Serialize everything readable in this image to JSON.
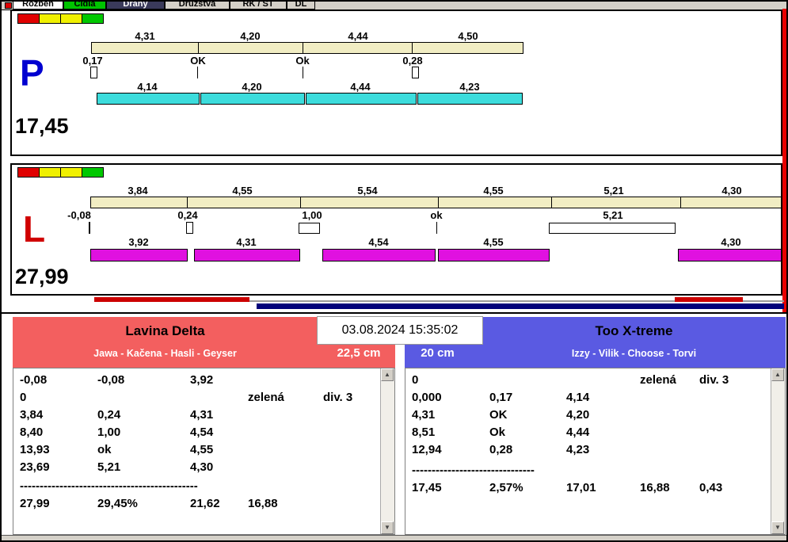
{
  "tabs": {
    "items": [
      "Rozbeh",
      "Čidla",
      "Dráhy",
      "Družstva",
      "RK / ST",
      "DL"
    ]
  },
  "lane_p": {
    "letter": "P",
    "total": "17,45",
    "splits": [
      "4,31",
      "4,20",
      "4,44",
      "4,50"
    ],
    "marks": [
      "0,17",
      "OK",
      "Ok",
      "0,28"
    ],
    "dogs": [
      "4,14",
      "4,20",
      "4,44",
      "4,23"
    ]
  },
  "lane_l": {
    "letter": "L",
    "total": "27,99",
    "splits": [
      "3,84",
      "4,55",
      "5,54",
      "4,55",
      "5,21",
      "4,30"
    ],
    "marks": [
      "-0,08",
      "0,24",
      "1,00",
      "ok",
      "5,21"
    ],
    "dogs": [
      "3,92",
      "4,31",
      "4,54",
      "4,55",
      "4,30"
    ]
  },
  "scoreboard": {
    "timestamp": "03.08.2024 15:35:02",
    "left": {
      "team": "Lavina Delta",
      "dogs": "Jawa - Kačena - Hasli - Geyser",
      "height": "22,5 cm",
      "rows": [
        [
          "-0,08",
          "-0,08",
          "3,92",
          "",
          ""
        ],
        [
          "0",
          "",
          "",
          "zelená",
          "div. 3"
        ],
        [
          "3,84",
          "0,24",
          "4,31",
          "",
          ""
        ],
        [
          "8,40",
          "1,00",
          "4,54",
          "",
          ""
        ],
        [
          "13,93",
          "ok",
          "4,55",
          "",
          ""
        ],
        [
          "23,69",
          "5,21",
          "4,30",
          "",
          ""
        ]
      ],
      "divider": "---------------------------------------------",
      "summary": [
        "27,99",
        "29,45%",
        "21,62",
        "16,88",
        ""
      ]
    },
    "right": {
      "team": "Too X-treme",
      "dogs": "Izzy - Vilik - Choose - Torvi",
      "height": "20 cm",
      "rows": [
        [
          "0",
          "",
          "",
          "zelená",
          "div. 3"
        ],
        [
          "0,000",
          "0,17",
          "4,14",
          "",
          ""
        ],
        [
          "4,31",
          "OK",
          "4,20",
          "",
          ""
        ],
        [
          "8,51",
          "Ok",
          "4,44",
          "",
          ""
        ],
        [
          "12,94",
          "0,28",
          "4,23",
          "",
          ""
        ]
      ],
      "divider": "-------------------------------",
      "summary": [
        "17,45",
        "2,57%",
        "17,01",
        "16,88",
        "0,43"
      ]
    }
  },
  "colors": {
    "split_bar": "#f1edc3",
    "lane_p_bar": "#3cdcdc",
    "lane_l_bar": "#e011e0",
    "lane_p_letter": "#0000d0",
    "lane_l_letter": "#d00000",
    "team_left_header": "#f35f5f",
    "team_right_header": "#5a5ae2",
    "light_red": "#e00000",
    "light_yellow": "#f0f000",
    "light_green": "#00c800",
    "progress_navy": "#00007a",
    "progress_red": "#cc0000"
  }
}
